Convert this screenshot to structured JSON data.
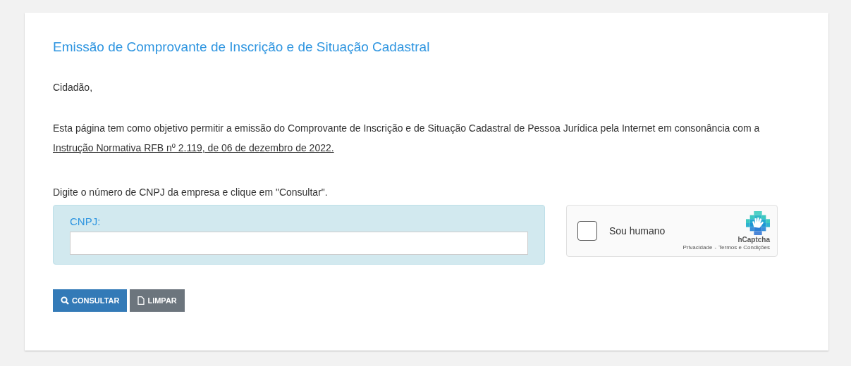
{
  "title": "Emissão de Comprovante de Inscrição e de Situação Cadastral",
  "greeting": "Cidadão,",
  "intro": {
    "text": "Esta página tem como objetivo permitir a emissão do Comprovante de Inscrição e de Situação Cadastral de Pessoa Jurídica pela Internet em consonância com a ",
    "link": "Instrução Normativa RFB nº 2.119, de 06 de dezembro de 2022."
  },
  "instruction": "Digite o número de CNPJ da empresa e clique em \"Consultar\".",
  "cnpj_field": {
    "label": "CNPJ:"
  },
  "captcha": {
    "checked": false,
    "label": "Sou humano",
    "brand": "hCaptcha",
    "privacy": "Privacidade",
    "separator": "-",
    "terms": "Termos e Condições"
  },
  "buttons": [
    {
      "kind": "primary",
      "label": "CONSULTAR"
    },
    {
      "kind": "secondary",
      "label": "LIMPAR"
    }
  ]
}
